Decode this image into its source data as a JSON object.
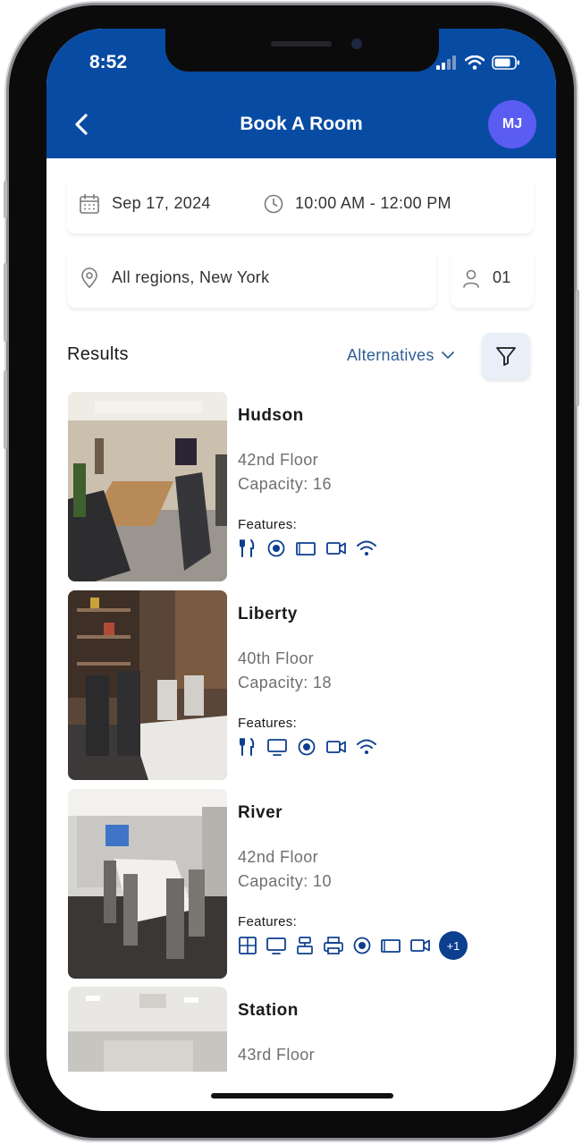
{
  "status_bar": {
    "time": "8:52"
  },
  "header": {
    "title": "Book A Room",
    "avatar_initials": "MJ"
  },
  "search": {
    "date": "Sep 17, 2024",
    "time_range": "10:00 AM - 12:00 PM",
    "location": "All regions, New York",
    "attendees": "01"
  },
  "results": {
    "label": "Results",
    "alternatives_label": "Alternatives",
    "rooms": [
      {
        "name": "Hudson",
        "floor": "42nd Floor",
        "capacity": "Capacity: 16",
        "features_label": "Features:",
        "features": [
          "catering-icon",
          "projector-icon",
          "display-icon",
          "video-icon",
          "wifi-icon"
        ]
      },
      {
        "name": "Liberty",
        "floor": "40th Floor",
        "capacity": "Capacity: 18",
        "features_label": "Features:",
        "features": [
          "catering-icon",
          "monitor-icon",
          "projector-icon",
          "video-icon",
          "wifi-icon"
        ]
      },
      {
        "name": "River",
        "floor": "42nd Floor",
        "capacity": "Capacity: 10",
        "features_label": "Features:",
        "features": [
          "whiteboard-icon",
          "monitor-icon",
          "phone-icon",
          "printer-icon",
          "projector-icon",
          "display-icon",
          "video-icon"
        ],
        "more_badge": "+1"
      },
      {
        "name": "Station",
        "floor": "43rd Floor"
      }
    ]
  },
  "colors": {
    "header": "#084ba3",
    "avatar": "#5a5cf2",
    "accent": "#2f5f96",
    "icon": "#0d3f8f"
  }
}
